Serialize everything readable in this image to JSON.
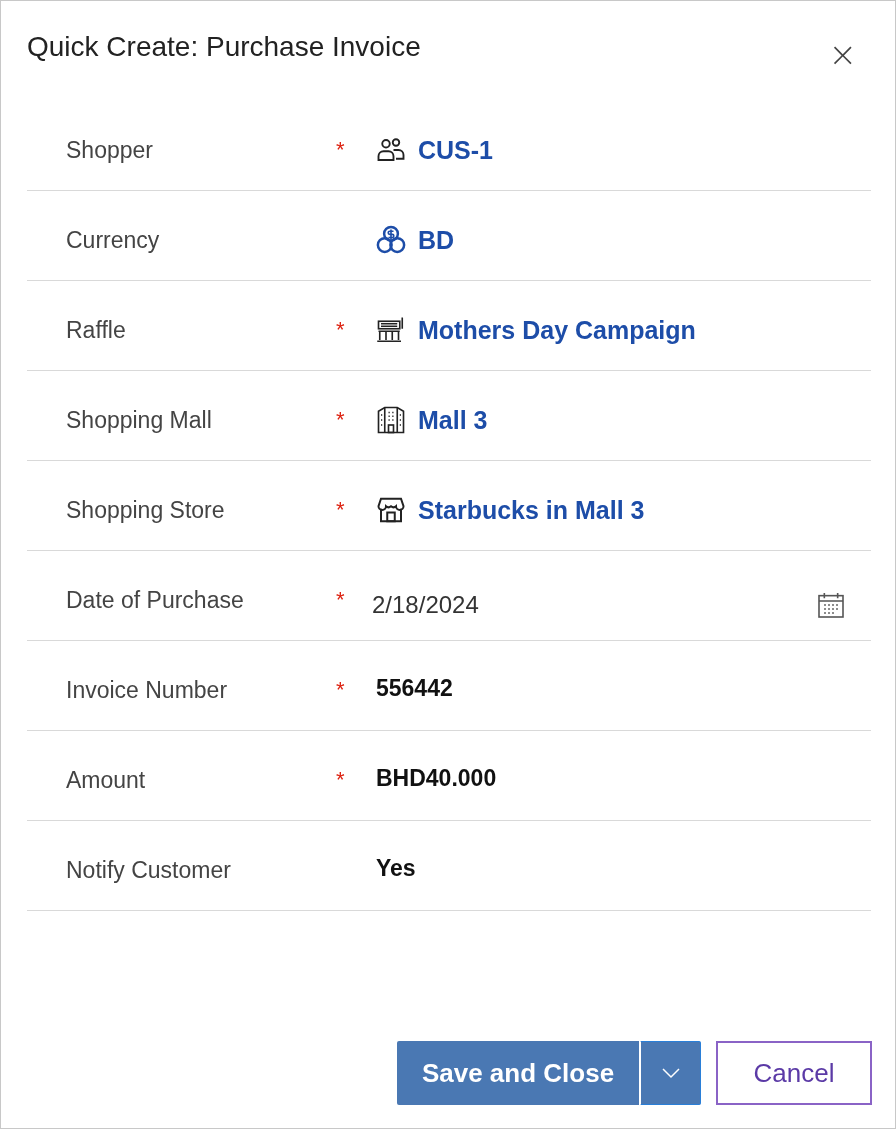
{
  "dialog": {
    "title": "Quick Create: Purchase Invoice",
    "close": "×"
  },
  "fields": [
    {
      "label": "Shopper",
      "required": true,
      "kind": "lookup",
      "value": "CUS-1"
    },
    {
      "label": "Currency",
      "required": false,
      "kind": "lookup",
      "value": "BD"
    },
    {
      "label": "Raffle",
      "required": true,
      "kind": "lookup",
      "value": "Mothers Day Campaign"
    },
    {
      "label": "Shopping Mall",
      "required": true,
      "kind": "lookup",
      "value": "Mall 3"
    },
    {
      "label": "Shopping Store",
      "required": true,
      "kind": "lookup",
      "value": "Starbucks in Mall 3"
    },
    {
      "label": "Date of Purchase",
      "required": true,
      "kind": "date",
      "value": "2/18/2024"
    },
    {
      "label": "Invoice Number",
      "required": true,
      "kind": "text",
      "value": "556442"
    },
    {
      "label": "Amount",
      "required": true,
      "kind": "text",
      "value": "BHD40.000"
    },
    {
      "label": "Notify Customer",
      "required": false,
      "kind": "text",
      "value": "Yes"
    }
  ],
  "required_mark": "*",
  "buttons": {
    "save": "Save and Close",
    "cancel": "Cancel"
  }
}
